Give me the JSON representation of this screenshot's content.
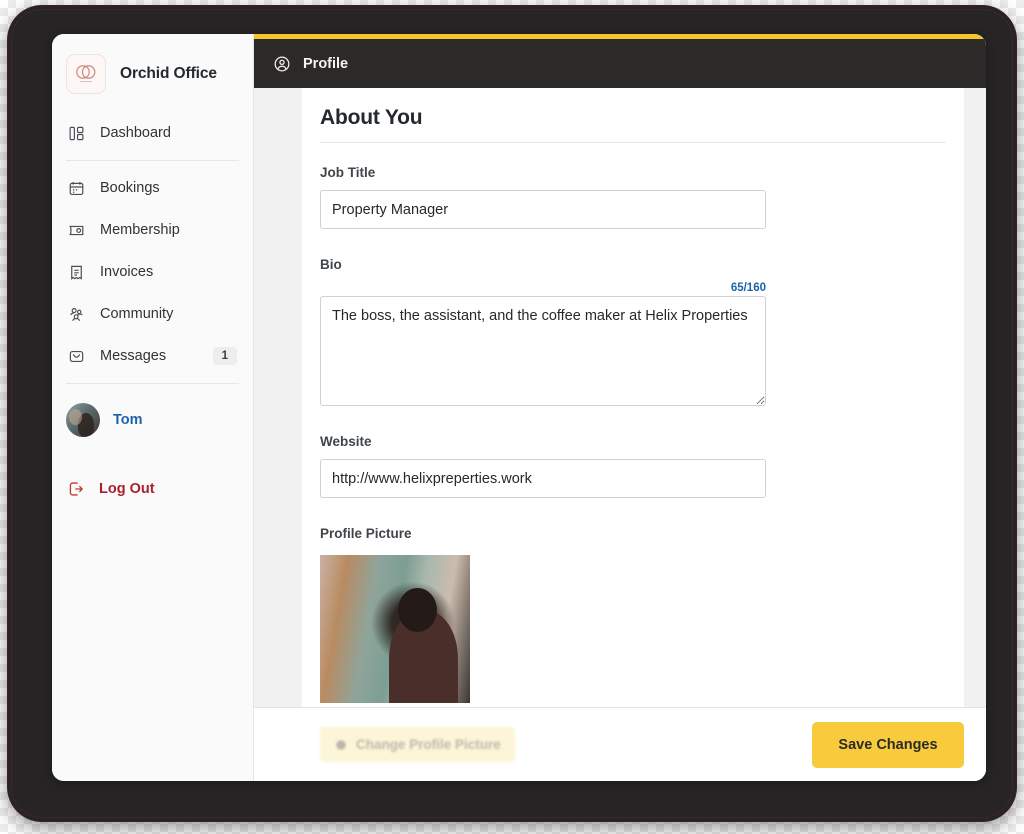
{
  "brand": {
    "name": "Orchid Office",
    "logo_icon": "orchid-rings-logo"
  },
  "sidebar": {
    "nav": [
      {
        "label": "Dashboard",
        "icon": "dashboard-icon",
        "badge": null
      },
      {
        "label": "Bookings",
        "icon": "calendar-icon",
        "badge": null
      },
      {
        "label": "Membership",
        "icon": "membership-card-icon",
        "badge": null
      },
      {
        "label": "Invoices",
        "icon": "invoice-icon",
        "badge": null
      },
      {
        "label": "Community",
        "icon": "people-icon",
        "badge": null
      },
      {
        "label": "Messages",
        "icon": "envelope-icon",
        "badge": "1"
      }
    ],
    "user": {
      "name": "Tom",
      "avatar_icon": "user-avatar"
    },
    "logout": {
      "label": "Log Out",
      "icon": "logout-icon"
    }
  },
  "topbar": {
    "title": "Profile",
    "icon": "user-circle-icon",
    "accent_color": "#f6c52c",
    "background_color": "#2b2a28"
  },
  "main": {
    "section_title": "About You",
    "fields": {
      "job_title": {
        "label": "Job Title",
        "value": "Property Manager",
        "placeholder": "Job Title"
      },
      "bio": {
        "label": "Bio",
        "value": "The boss, the assistant, and the coffee maker at Helix Properties",
        "placeholder": "Bio",
        "counter": "65/160",
        "counter_color": "#1b62ab",
        "char_count": 65,
        "char_limit": 160
      },
      "website": {
        "label": "Website",
        "value": "http://www.helixpreperties.work",
        "placeholder": "Website"
      },
      "profile_picture": {
        "label": "Profile Picture",
        "image_alt": "profile-photo-preview"
      }
    }
  },
  "footer": {
    "change_picture_label": "Change Profile Picture",
    "change_picture_icon": "upload-icon",
    "save_label": "Save Changes",
    "save_color": "#f8cb3c"
  }
}
